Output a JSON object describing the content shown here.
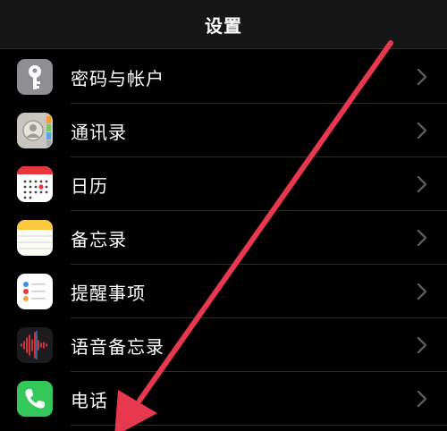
{
  "header": {
    "title": "设置"
  },
  "items": [
    {
      "label": "密码与帐户",
      "icon": "key-icon"
    },
    {
      "label": "通讯录",
      "icon": "contacts-icon"
    },
    {
      "label": "日历",
      "icon": "calendar-icon"
    },
    {
      "label": "备忘录",
      "icon": "notes-icon"
    },
    {
      "label": "提醒事项",
      "icon": "reminders-icon"
    },
    {
      "label": "语音备忘录",
      "icon": "voice-memos-icon"
    },
    {
      "label": "电话",
      "icon": "phone-icon"
    }
  ],
  "colors": {
    "background": "#000000",
    "navbar": "#161616",
    "separator": "#2c2c2e",
    "chevron": "#5a5a5e",
    "annotation_arrow": "#e8384f"
  }
}
